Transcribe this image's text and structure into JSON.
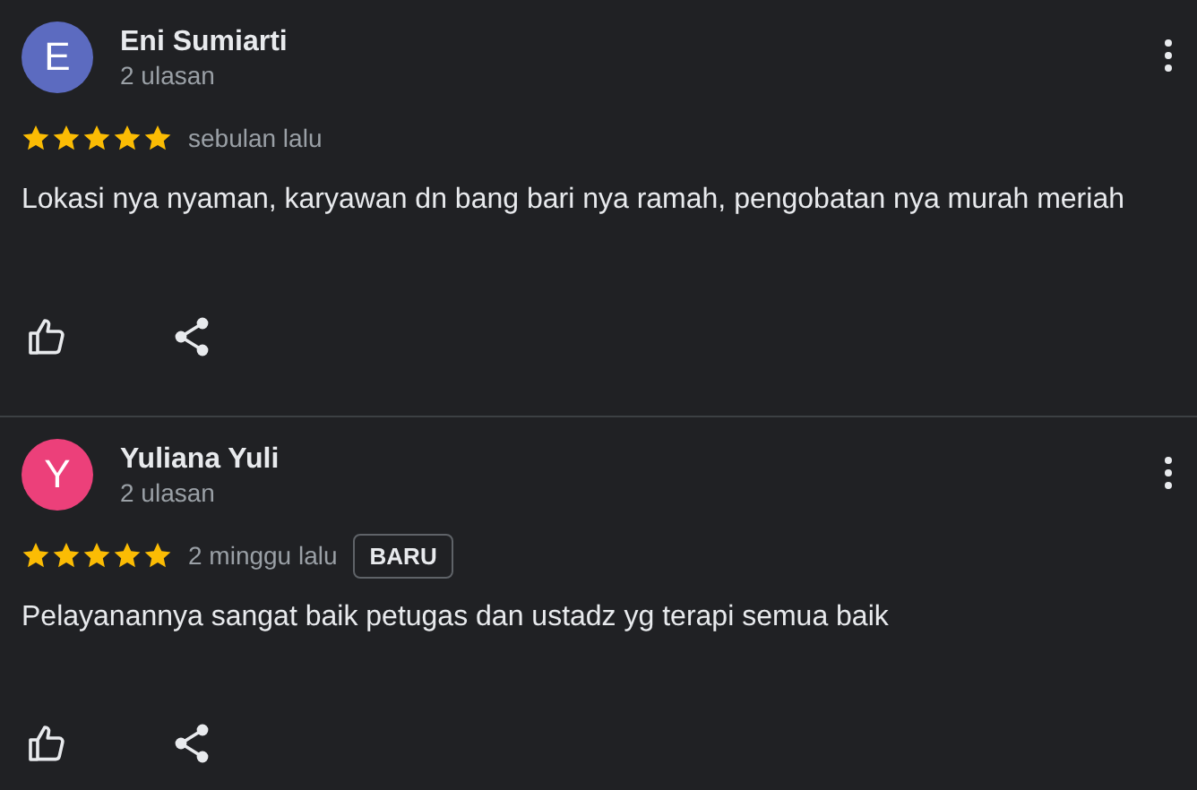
{
  "reviews": [
    {
      "initial": "E",
      "color": "#5c6bc0",
      "name": "Eni Sumiarti",
      "count": "2 ulasan",
      "stars": 5,
      "time": "sebulan lalu",
      "text": "Lokasi nya nyaman, karyawan dn bang bari nya ramah, pengobatan nya murah meriah"
    },
    {
      "initial": "Y",
      "color": "#ec407a",
      "name": "Yuliana Yuli",
      "count": "2 ulasan",
      "stars": 5,
      "time": "2 minggu lalu",
      "badge": "BARU",
      "text": "Pelayanannya sangat baik petugas dan ustadz yg terapi semua baik"
    }
  ]
}
